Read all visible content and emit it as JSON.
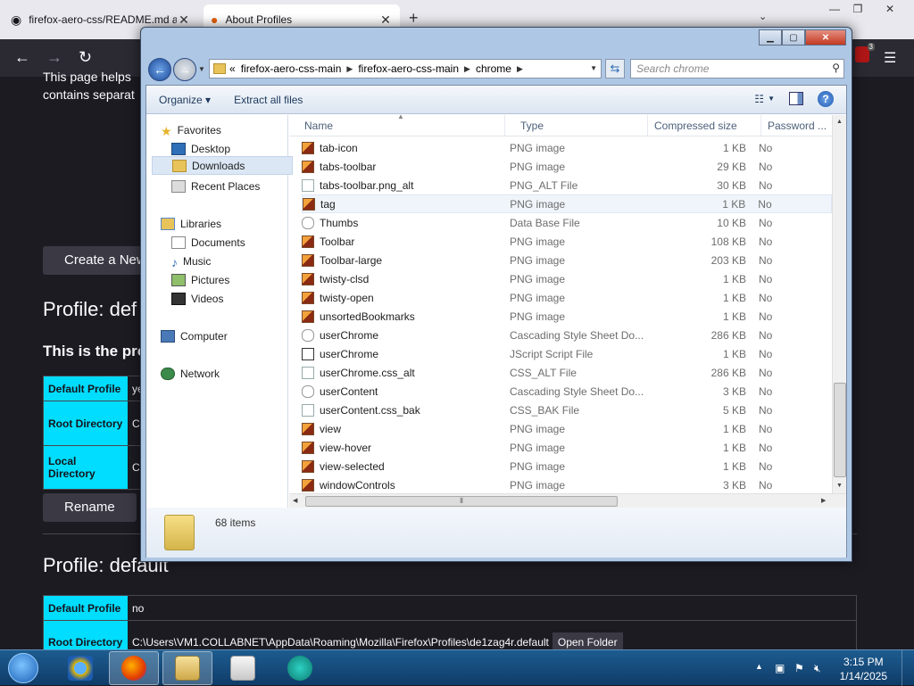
{
  "firefox": {
    "tabs": [
      {
        "title": "firefox-aero-css/README.md at"
      },
      {
        "title": "About Profiles"
      }
    ],
    "new_tab": "+",
    "tab_list": "⌄",
    "win_minimize": "—",
    "win_restore": "❐",
    "win_close": "✕",
    "nav_back": "←",
    "nav_forward": "→",
    "nav_reload": "↻",
    "menu": "☰",
    "ext_badge_count": "3"
  },
  "page": {
    "intro_line1": "This page helps",
    "intro_line2": "contains separat",
    "create_button": "Create a New",
    "profile1_heading": "Profile: def",
    "profile1_subheading": "This is the pro",
    "profile1_rows": [
      {
        "key": "Default Profile",
        "value": "ye"
      },
      {
        "key": "Root Directory",
        "value": "C"
      },
      {
        "key": "Local Directory",
        "value": "C"
      }
    ],
    "rename_button": "Rename",
    "profile2_heading": "Profile: default",
    "profile2_rows": [
      {
        "key": "Default Profile",
        "value": "no",
        "folder": ""
      },
      {
        "key": "Root Directory",
        "value": "C:\\Users\\VM1.COLLABNET\\AppData\\Roaming\\Mozilla\\Firefox\\Profiles\\de1zag4r.default",
        "folder": "Open Folder"
      }
    ]
  },
  "explorer": {
    "address": {
      "overflow": "«",
      "crumbs": [
        "firefox-aero-css-main",
        "firefox-aero-css-main",
        "chrome"
      ],
      "search_placeholder": "Search chrome"
    },
    "commands": {
      "organize": "Organize ▾",
      "extract": "Extract all files"
    },
    "nav": {
      "favorites": "Favorites",
      "desktop": "Desktop",
      "downloads": "Downloads",
      "recent": "Recent Places",
      "libraries": "Libraries",
      "documents": "Documents",
      "music": "Music",
      "pictures": "Pictures",
      "videos": "Videos",
      "computer": "Computer",
      "network": "Network"
    },
    "columns": {
      "name": "Name",
      "type": "Type",
      "size": "Compressed size",
      "password": "Password ..."
    },
    "files": [
      {
        "name": "tab-icon",
        "type": "PNG image",
        "size": "1 KB",
        "password": "No",
        "icon": "png"
      },
      {
        "name": "tabs-toolbar",
        "type": "PNG image",
        "size": "29 KB",
        "password": "No",
        "icon": "png"
      },
      {
        "name": "tabs-toolbar.png_alt",
        "type": "PNG_ALT File",
        "size": "30 KB",
        "password": "No",
        "icon": "plain"
      },
      {
        "name": "tag",
        "type": "PNG image",
        "size": "1 KB",
        "password": "No",
        "icon": "png"
      },
      {
        "name": "Thumbs",
        "type": "Data Base File",
        "size": "10 KB",
        "password": "No",
        "icon": "db"
      },
      {
        "name": "Toolbar",
        "type": "PNG image",
        "size": "108 KB",
        "password": "No",
        "icon": "png"
      },
      {
        "name": "Toolbar-large",
        "type": "PNG image",
        "size": "203 KB",
        "password": "No",
        "icon": "png"
      },
      {
        "name": "twisty-clsd",
        "type": "PNG image",
        "size": "1 KB",
        "password": "No",
        "icon": "png"
      },
      {
        "name": "twisty-open",
        "type": "PNG image",
        "size": "1 KB",
        "password": "No",
        "icon": "png"
      },
      {
        "name": "unsortedBookmarks",
        "type": "PNG image",
        "size": "1 KB",
        "password": "No",
        "icon": "png"
      },
      {
        "name": "userChrome",
        "type": "Cascading Style Sheet Do...",
        "size": "286 KB",
        "password": "No",
        "icon": "css"
      },
      {
        "name": "userChrome",
        "type": "JScript Script File",
        "size": "1 KB",
        "password": "No",
        "icon": "js"
      },
      {
        "name": "userChrome.css_alt",
        "type": "CSS_ALT File",
        "size": "286 KB",
        "password": "No",
        "icon": "plain"
      },
      {
        "name": "userContent",
        "type": "Cascading Style Sheet Do...",
        "size": "3 KB",
        "password": "No",
        "icon": "css"
      },
      {
        "name": "userContent.css_bak",
        "type": "CSS_BAK File",
        "size": "5 KB",
        "password": "No",
        "icon": "plain"
      },
      {
        "name": "view",
        "type": "PNG image",
        "size": "1 KB",
        "password": "No",
        "icon": "png"
      },
      {
        "name": "view-hover",
        "type": "PNG image",
        "size": "1 KB",
        "password": "No",
        "icon": "png"
      },
      {
        "name": "view-selected",
        "type": "PNG image",
        "size": "1 KB",
        "password": "No",
        "icon": "png"
      },
      {
        "name": "windowControls",
        "type": "PNG image",
        "size": "3 KB",
        "password": "No",
        "icon": "png"
      }
    ],
    "item_count": "68 items",
    "hover_row": 3
  },
  "taskbar": {
    "time": "3:15 PM",
    "date": "1/14/2025"
  }
}
